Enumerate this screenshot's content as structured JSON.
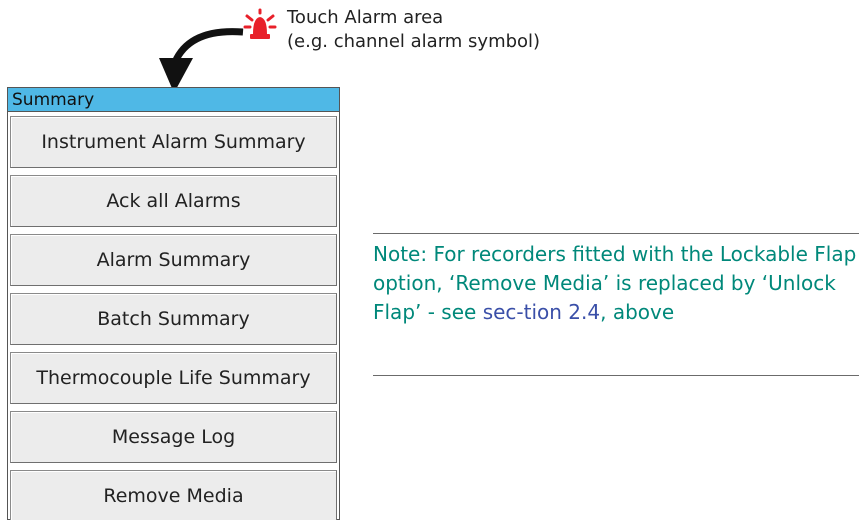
{
  "callout": {
    "line1": "Touch Alarm area",
    "line2": "(e.g. channel alarm symbol)",
    "icon": "alarm-bell-icon"
  },
  "menu": {
    "title": "Summary",
    "items": [
      {
        "label": "Instrument Alarm Summary"
      },
      {
        "label": "Ack all Alarms"
      },
      {
        "label": "Alarm Summary"
      },
      {
        "label": "Batch Summary"
      },
      {
        "label": "Thermocouple Life Summary"
      },
      {
        "label": "Message Log"
      },
      {
        "label": "Remove Media"
      }
    ]
  },
  "note": {
    "text_before": "Note:  For recorders fitted with the Lockable Flap option, ‘Remove Media’ is replaced by ‘Unlock Flap’ - see ",
    "link_text": "sec-tion 2.4",
    "text_after": ", above"
  },
  "colors": {
    "title_bar": "#4fb8e6",
    "button_bg": "#ececec",
    "note_text": "#00887a",
    "link": "#3a4fa8",
    "alarm_red": "#e8202a"
  }
}
